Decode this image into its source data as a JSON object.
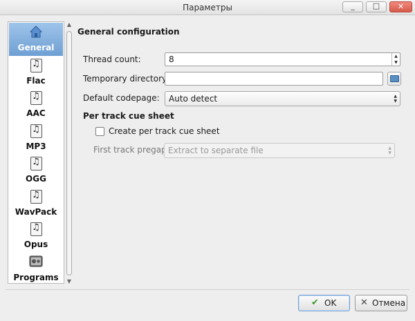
{
  "window": {
    "title": "Параметры"
  },
  "sidebar": {
    "items": [
      {
        "label": "General",
        "icon": "home-icon",
        "selected": true
      },
      {
        "label": "Flac",
        "icon": "music-note-icon"
      },
      {
        "label": "AAC",
        "icon": "music-note-icon"
      },
      {
        "label": "MP3",
        "icon": "music-note-icon"
      },
      {
        "label": "OGG",
        "icon": "music-note-icon"
      },
      {
        "label": "WavPack",
        "icon": "music-note-icon"
      },
      {
        "label": "Opus",
        "icon": "music-note-icon"
      },
      {
        "label": "Programs",
        "icon": "programs-icon"
      }
    ]
  },
  "general": {
    "section_title": "General configuration",
    "thread_count_label": "Thread count:",
    "thread_count_value": "8",
    "temp_dir_label": "Temporary directory:",
    "temp_dir_value": "",
    "codepage_label": "Default codepage:",
    "codepage_value": "Auto detect",
    "cue_section_title": "Per track cue sheet",
    "create_cue_label": "Create per track cue sheet",
    "create_cue_checked": false,
    "pregap_label": "First track pregap:",
    "pregap_value": "Extract to separate file"
  },
  "buttons": {
    "ok": "OK",
    "cancel": "Отмена"
  },
  "colors": {
    "selection": "#7aa7d8",
    "ok_icon": "#3c9a2c"
  }
}
